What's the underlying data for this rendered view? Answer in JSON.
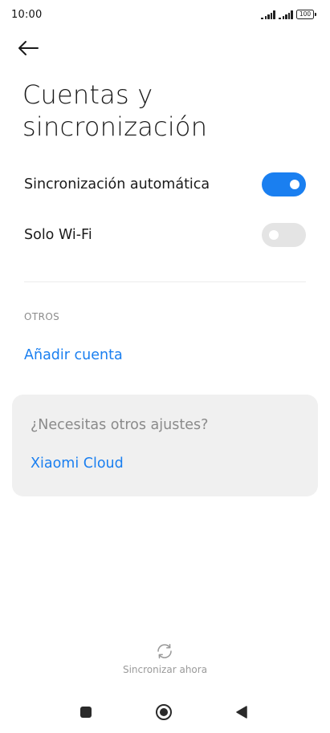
{
  "status_bar": {
    "time": "10:00",
    "battery": "100"
  },
  "header": {
    "back_icon": "arrow-left-icon",
    "title": "Cuentas y sincronización"
  },
  "settings": {
    "auto_sync": {
      "label": "Sincronización automática",
      "enabled": true
    },
    "wifi_only": {
      "label": "Solo Wi-Fi",
      "enabled": false
    }
  },
  "others": {
    "section_title": "OTROS",
    "add_account": "Añadir cuenta"
  },
  "card": {
    "question": "¿Necesitas otros ajustes?",
    "link": "Xiaomi Cloud"
  },
  "footer": {
    "sync_now": "Sincronizar ahora",
    "sync_icon": "sync-icon"
  },
  "nav": {
    "recents_icon": "square-icon",
    "home_icon": "circle-icon",
    "back_icon": "triangle-back-icon"
  },
  "colors": {
    "accent": "#1a7ff0",
    "toggle_off": "#e4e4e4",
    "card_bg": "#f0f0f0"
  }
}
